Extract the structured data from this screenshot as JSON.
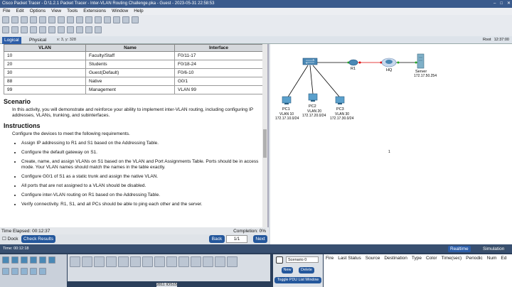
{
  "window": {
    "title": "Cisco Packet Tracer - D:\\1.2.1 Packet Tracer - Inter-VLAN Routing Challenge.pka - Guest - 2023-05-31 22:58:53"
  },
  "menu": [
    "File",
    "Edit",
    "Options",
    "View",
    "Tools",
    "Extensions",
    "Window",
    "Help"
  ],
  "tabs": {
    "logical": "Logical",
    "physical": "Physical",
    "coords": "x: 3, y: 328",
    "root": "Root",
    "clock": "12:37:00"
  },
  "vlan_table": {
    "headers": [
      "VLAN",
      "Name",
      "Interface"
    ],
    "rows": [
      [
        "10",
        "Faculty/Staff",
        "F0/11-17"
      ],
      [
        "20",
        "Students",
        "F0/18-24"
      ],
      [
        "30",
        "Guest(Default)",
        "F0/6-10"
      ],
      [
        "88",
        "Native",
        "G0/1"
      ],
      [
        "99",
        "Management",
        "VLAN 99"
      ]
    ]
  },
  "scenario": {
    "heading": "Scenario",
    "text": "In this activity, you will demonstrate and reinforce your ability to implement inter-VLAN routing, including configuring IP addresses, VLANs, trunking, and subinterfaces."
  },
  "instructions": {
    "heading": "Instructions",
    "intro": "Configure the devices to meet the following requirements.",
    "items": [
      "Assign IP addressing to R1 and S1 based on the Addressing Table.",
      "Configure the default gateway on S1.",
      "Create, name, and assign VLANs on S1 based on the VLAN and Port Assignments Table. Ports should be in access mode. Your VLAN names should match the names in the table exactly.",
      "Configure G0/1 of S1 as a static trunk and assign the native VLAN.",
      "All ports that are not assigned to a VLAN should be disabled.",
      "Configure inter-VLAN routing on R1 based on the Addressing Table.",
      "Verify connectivity. R1, S1, and all PCs should be able to ping each other and the server."
    ]
  },
  "status": {
    "elapsed": "Time Elapsed: 00:12:37",
    "completion": "Completion: 0%"
  },
  "nav": {
    "dock": "Dock",
    "check": "Check Results",
    "back": "Back",
    "page": "1/1",
    "next": "Next"
  },
  "topology": {
    "r1": "R1",
    "hq": "HQ",
    "server": "Server",
    "server_ip": "172.17.50.254",
    "pc1": "PC1",
    "pc1_vlan": "VLAN 10",
    "pc1_ip": "172.17.10.0/24",
    "pc2": "PC2",
    "pc2_vlan": "VLAN 20",
    "pc2_ip": "172.17.20.0/24",
    "pc3": "PC3",
    "pc3_vlan": "VLAN 30",
    "pc3_ip": "172.17.30.0/24",
    "marker": "1"
  },
  "bottom": {
    "time": "Time: 00:12:18",
    "realtime": "Realtime",
    "simulation": "Simulation",
    "scenario_select": "Scenario 0",
    "new": "New",
    "delete": "Delete",
    "toggle": "Toggle PDU List Window",
    "pdu_headers": [
      "Fire",
      "Last Status",
      "Source",
      "Destination",
      "Type",
      "Color",
      "Time(sec)",
      "Periodic",
      "Num",
      "Ed"
    ],
    "model": "2811 IOS15"
  }
}
